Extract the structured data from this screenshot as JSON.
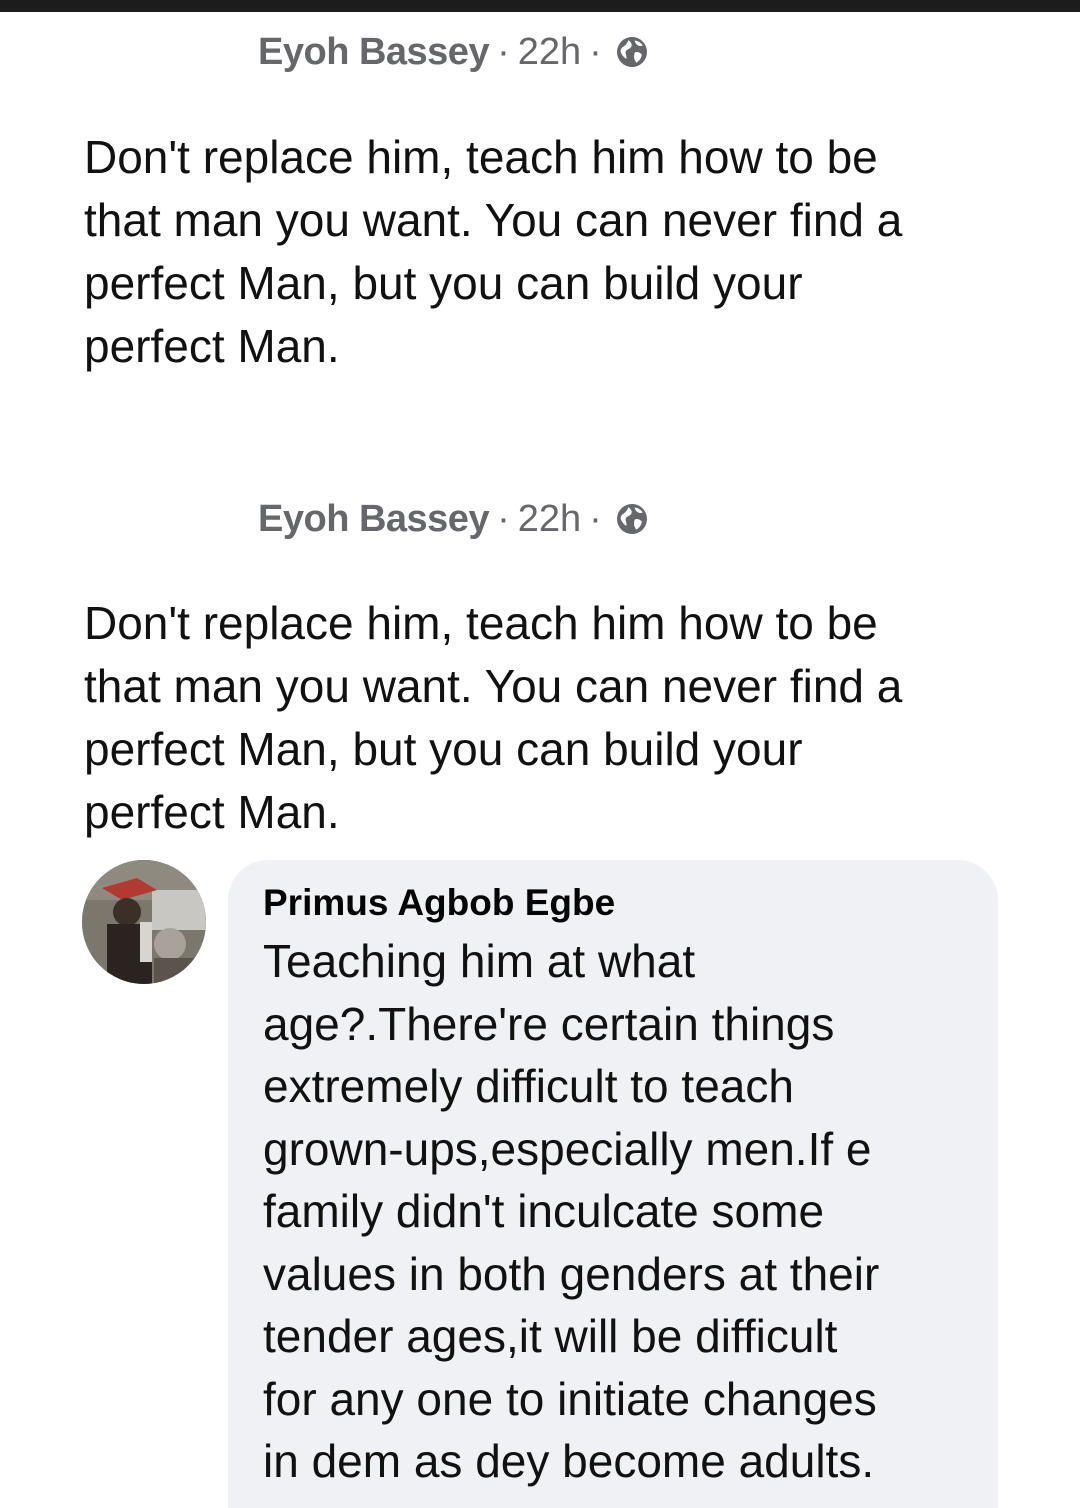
{
  "posts": [
    {
      "author": "Eyoh Bassey",
      "time": "22h",
      "separator": "·",
      "privacy_icon": "globe-icon",
      "lines": [
        "Don't replace him, teach him how to be",
        "that man you want. You can never find a",
        "perfect Man, but you can build your",
        "perfect Man."
      ]
    },
    {
      "author": "Eyoh Bassey",
      "time": "22h",
      "separator": "·",
      "privacy_icon": "globe-icon",
      "lines": [
        "Don't replace him, teach him how to be",
        "that man you want. You can never find a",
        "perfect Man, but you can build your",
        "perfect Man."
      ]
    }
  ],
  "comment": {
    "author": "Primus Agbob Egbe",
    "avatar_icon": "avatar",
    "lines": [
      "Teaching him at what",
      "age?.There're certain things",
      "extremely difficult to teach",
      "grown-ups,especially men.If e",
      "family didn't inculcate some",
      "values in both genders at their",
      "tender ages,it will be difficult",
      "for any one to initiate changes",
      "in dem as dey become adults."
    ]
  },
  "colors": {
    "meta_text": "#65676b",
    "body_text": "#111111",
    "bubble_bg": "#f0f1f5",
    "status_bar": "#1c1c1c"
  }
}
